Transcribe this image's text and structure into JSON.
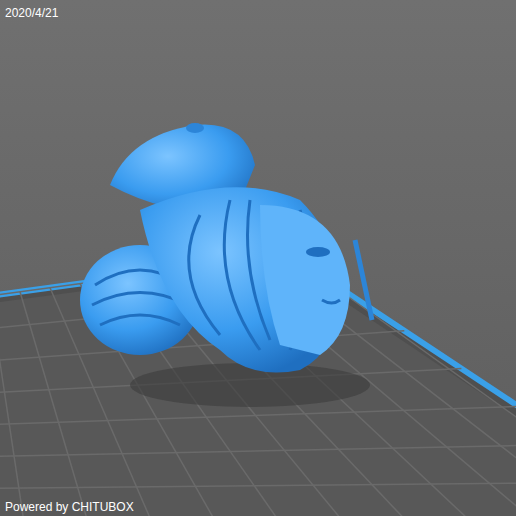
{
  "viewport": {
    "date": "2020/4/21",
    "footer": "Powered by CHITUBOX"
  }
}
